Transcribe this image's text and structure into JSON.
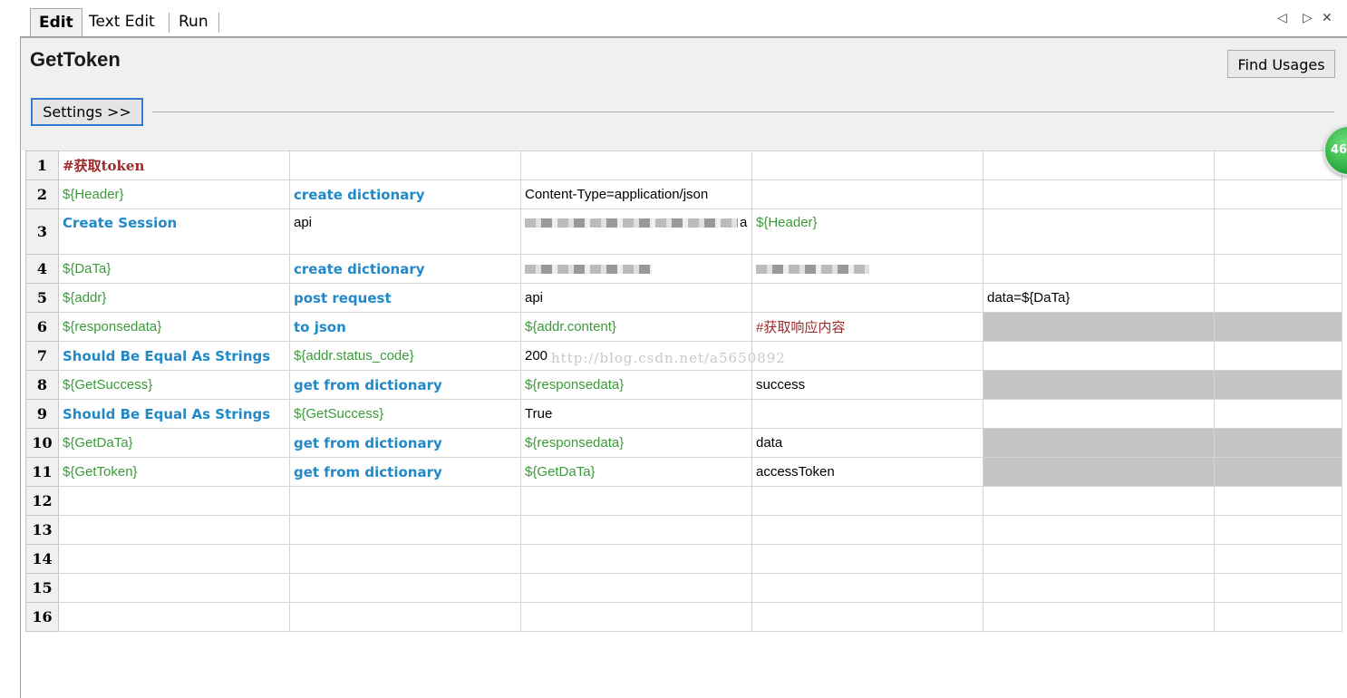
{
  "tabs": [
    {
      "label": "Edit"
    },
    {
      "label": "Text Edit"
    },
    {
      "label": "Run"
    }
  ],
  "tab_controls": {
    "prev": "◁",
    "next": "▷",
    "close": "✕"
  },
  "header": {
    "title": "GetToken",
    "find_usages_label": "Find Usages",
    "settings_label": "Settings >>"
  },
  "badge": {
    "text": "46"
  },
  "watermark": "http://blog.csdn.net/a5650892",
  "rows": [
    {
      "num": "1",
      "cells": [
        "#获取token",
        "",
        "",
        "",
        "",
        ""
      ]
    },
    {
      "num": "2",
      "cells": [
        "${Header}",
        "create dictionary",
        "Content-Type=application/json",
        "",
        "",
        ""
      ]
    },
    {
      "num": "3",
      "cells": [
        "Create Session",
        "api",
        "a",
        "${Header}",
        "",
        ""
      ]
    },
    {
      "num": "4",
      "cells": [
        "${DaTa}",
        "create dictionary",
        "",
        "",
        "",
        ""
      ]
    },
    {
      "num": "5",
      "cells": [
        "${addr}",
        "post request",
        "api",
        "",
        "data=${DaTa}",
        ""
      ]
    },
    {
      "num": "6",
      "cells": [
        "${responsedata}",
        "to json",
        "${addr.content}",
        "#获取响应内容",
        "",
        ""
      ]
    },
    {
      "num": "7",
      "cells": [
        "Should Be Equal As Strings",
        "${addr.status_code}",
        "200",
        "",
        "",
        ""
      ]
    },
    {
      "num": "8",
      "cells": [
        "${GetSuccess}",
        "get from dictionary",
        "${responsedata}",
        "success",
        "",
        ""
      ]
    },
    {
      "num": "9",
      "cells": [
        "Should Be Equal As Strings",
        "${GetSuccess}",
        "True",
        "",
        "",
        ""
      ]
    },
    {
      "num": "10",
      "cells": [
        "${GetDaTa}",
        "get from dictionary",
        "${responsedata}",
        "data",
        "",
        ""
      ]
    },
    {
      "num": "11",
      "cells": [
        "${GetToken}",
        "get from dictionary",
        "${GetDaTa}",
        "accessToken",
        "",
        ""
      ]
    },
    {
      "num": "12",
      "cells": [
        "",
        "",
        "",
        "",
        "",
        ""
      ]
    },
    {
      "num": "13",
      "cells": [
        "",
        "",
        "",
        "",
        "",
        ""
      ]
    },
    {
      "num": "14",
      "cells": [
        "",
        "",
        "",
        "",
        "",
        ""
      ]
    },
    {
      "num": "15",
      "cells": [
        "",
        "",
        "",
        "",
        "",
        ""
      ]
    },
    {
      "num": "16",
      "cells": [
        "",
        "",
        "",
        "",
        "",
        ""
      ]
    }
  ]
}
